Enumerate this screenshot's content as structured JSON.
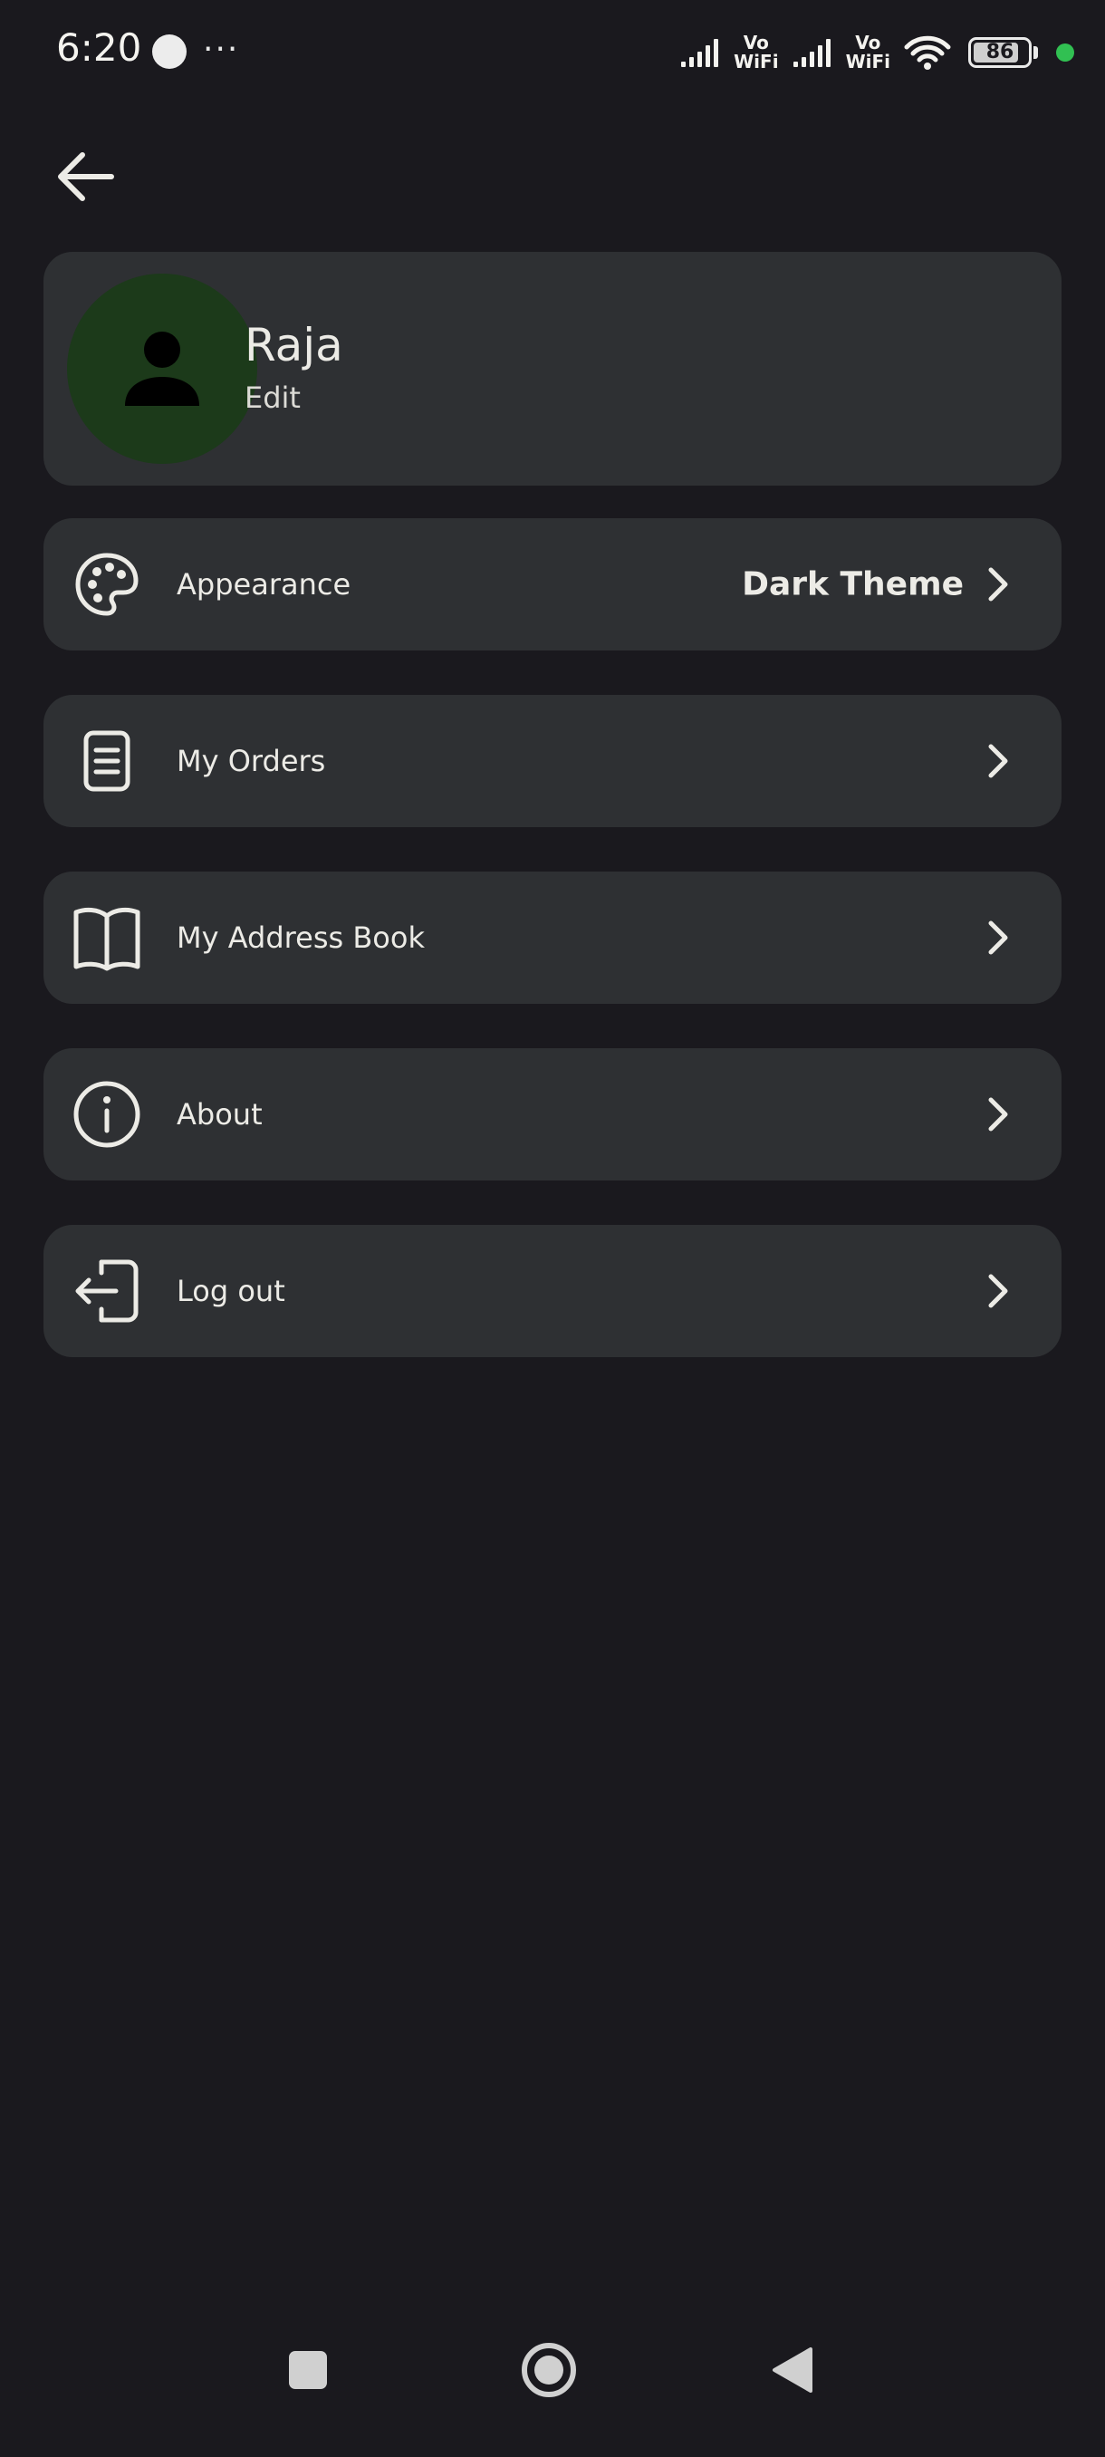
{
  "status_bar": {
    "time": "6:20",
    "more": "···",
    "vowifi_1_top": "Vo",
    "vowifi_1_bottom": "WiFi",
    "vowifi_2_top": "Vo",
    "vowifi_2_bottom": "WiFi",
    "battery": "86",
    "battery_level": 0.86
  },
  "profile": {
    "name": "Raja",
    "edit_label": "Edit"
  },
  "menu": [
    {
      "label": "Appearance",
      "value": "Dark Theme",
      "icon": "palette-icon"
    },
    {
      "label": "My Orders",
      "value": "",
      "icon": "document-icon"
    },
    {
      "label": "My Address Book",
      "value": "",
      "icon": "book-icon"
    },
    {
      "label": "About",
      "value": "",
      "icon": "info-icon"
    },
    {
      "label": "Log out",
      "value": "",
      "icon": "logout-icon"
    }
  ],
  "colors": {
    "background": "#1a191e",
    "card": "#2e3033",
    "avatar_bg": "#1c3a1a",
    "text": "#ecebe6",
    "status_green": "#31c052"
  }
}
